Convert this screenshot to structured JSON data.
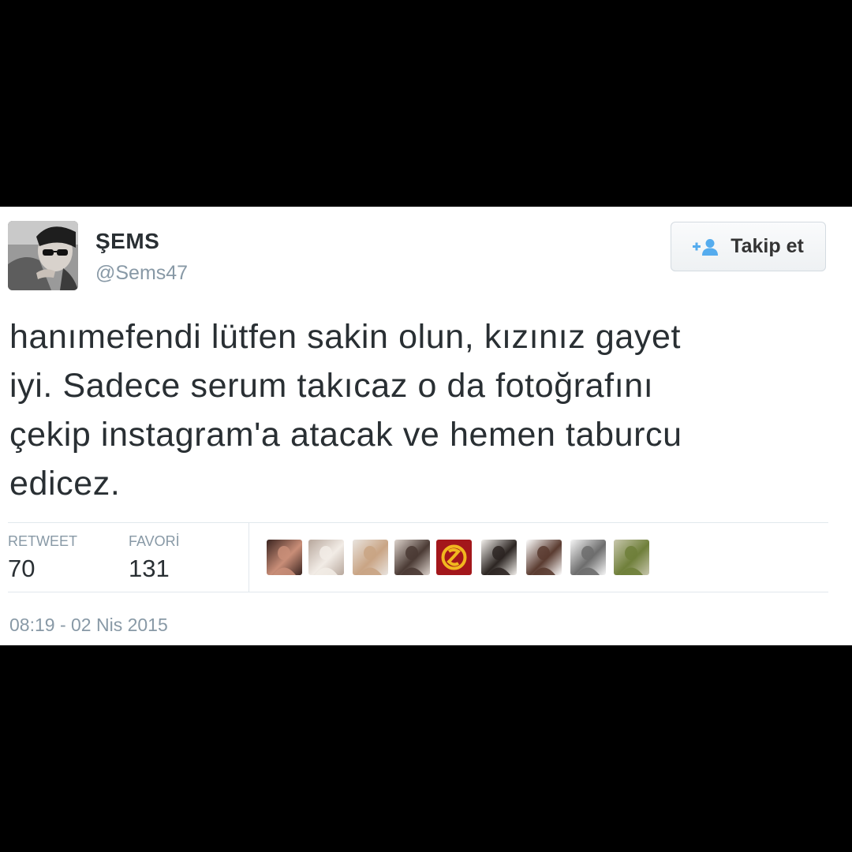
{
  "user": {
    "display_name": "ŞEMS",
    "handle": "@Sems47"
  },
  "follow_button": {
    "label": "Takip et",
    "icon": "follow-user-plus-icon"
  },
  "tweet": {
    "lines": [
      "hanımefendi lütfen sakin olun, kızınız gayet",
      "iyi. Sadece serum takıcaz o da fotoğrafını",
      "çekip instagram'a atacak ve hemen taburcu",
      "edicez."
    ]
  },
  "stats": {
    "retweet_label": "RETWEET",
    "retweet_count": "70",
    "favorite_label": "FAVORİ",
    "favorite_count": "131"
  },
  "favoriters": [
    {
      "name": "favoriter-avatar-1",
      "colors": [
        "#3a2420",
        "#c98e78"
      ]
    },
    {
      "name": "favoriter-avatar-2",
      "colors": [
        "#b7a79c",
        "#f2ece6"
      ]
    },
    {
      "name": "favoriter-avatar-3",
      "colors": [
        "#e9e4df",
        "#c9a484"
      ]
    },
    {
      "name": "favoriter-avatar-4",
      "colors": [
        "#ddd3cc",
        "#4a3a34"
      ]
    },
    {
      "name": "favoriter-avatar-5",
      "colors": [
        "#a3171b",
        "#f1b81f"
      ]
    },
    {
      "name": "favoriter-avatar-6",
      "colors": [
        "#f3f0ec",
        "#2c2522"
      ]
    },
    {
      "name": "favoriter-avatar-7",
      "colors": [
        "#ffffff",
        "#5a3b30"
      ]
    },
    {
      "name": "favoriter-avatar-8",
      "colors": [
        "#f6f6f6",
        "#6d6d6d"
      ]
    },
    {
      "name": "favoriter-avatar-9",
      "colors": [
        "#c8c7ad",
        "#6f7f3a"
      ]
    }
  ],
  "timestamp": "08:19 - 02 Nis 2015",
  "colors": {
    "text_primary": "#292f33",
    "text_secondary": "#8899a6",
    "follow_icon": "#55acee",
    "divider": "#e1e8ed"
  }
}
